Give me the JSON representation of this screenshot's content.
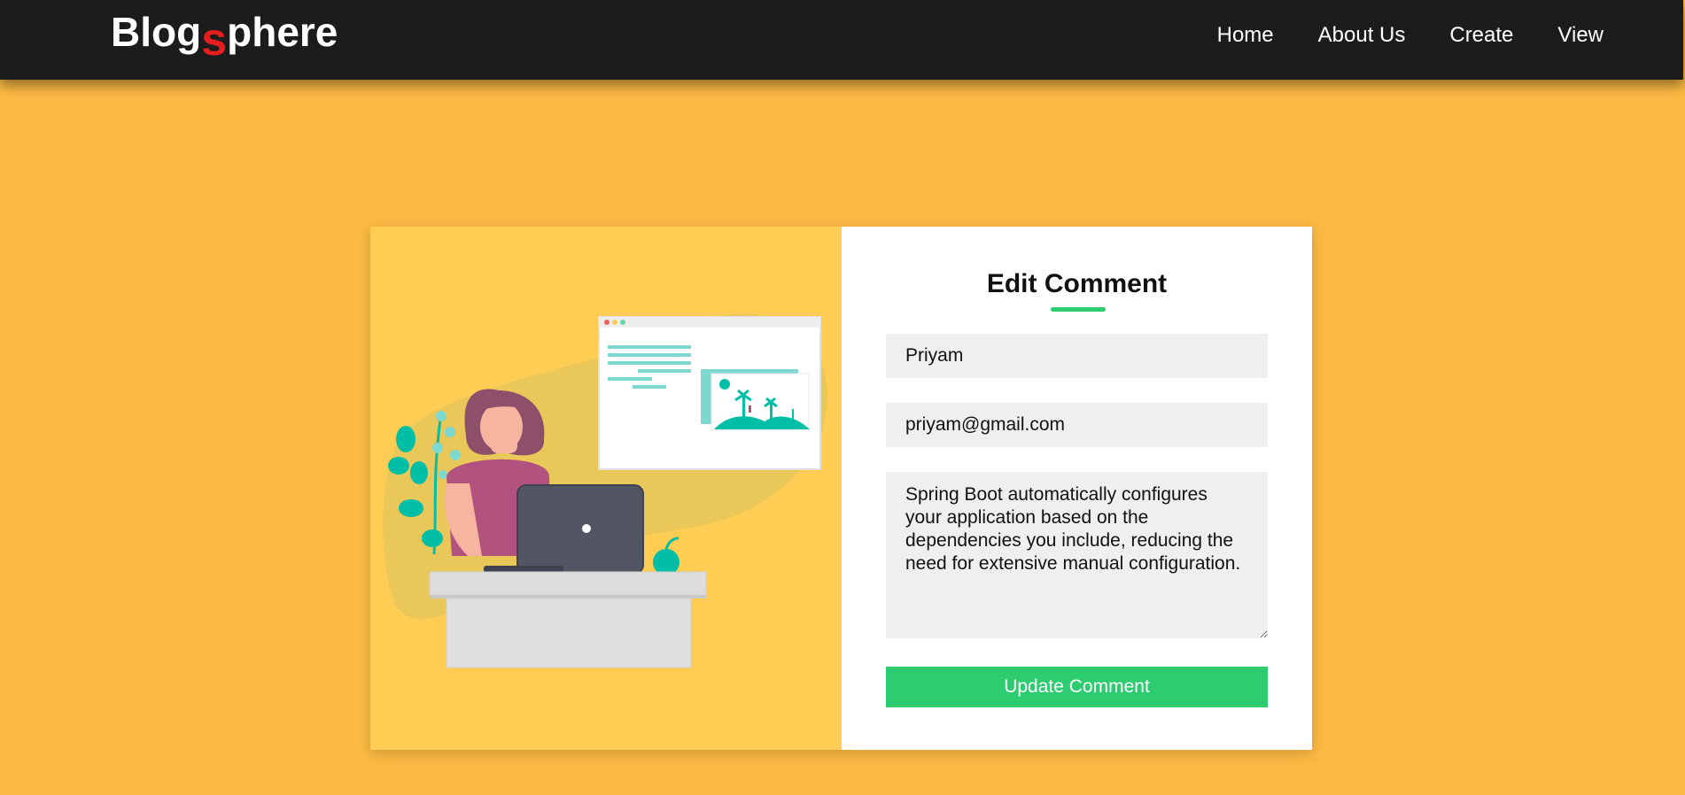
{
  "brand": {
    "prefix": "Blog",
    "accent": "s",
    "suffix": "phere"
  },
  "nav": {
    "items": [
      {
        "label": "Home"
      },
      {
        "label": "About Us"
      },
      {
        "label": "Create"
      },
      {
        "label": "View"
      }
    ]
  },
  "form": {
    "title": "Edit Comment",
    "name_value": "Priyam",
    "email_value": "priyam@gmail.com",
    "comment_value": "Spring Boot automatically configures your application based on the dependencies you include, reducing the need for extensive manual configuration.",
    "submit_label": "Update Comment"
  },
  "illustration": {
    "icon": "woman-at-laptop-illustration"
  },
  "colors": {
    "page_background": "#FBBA43",
    "navbar_background": "#1C1C1C",
    "brand_accent": "#E51E1E",
    "panel_left": "#FFCD53",
    "button": "#2ECC71",
    "field_background": "#EFEFEF"
  }
}
